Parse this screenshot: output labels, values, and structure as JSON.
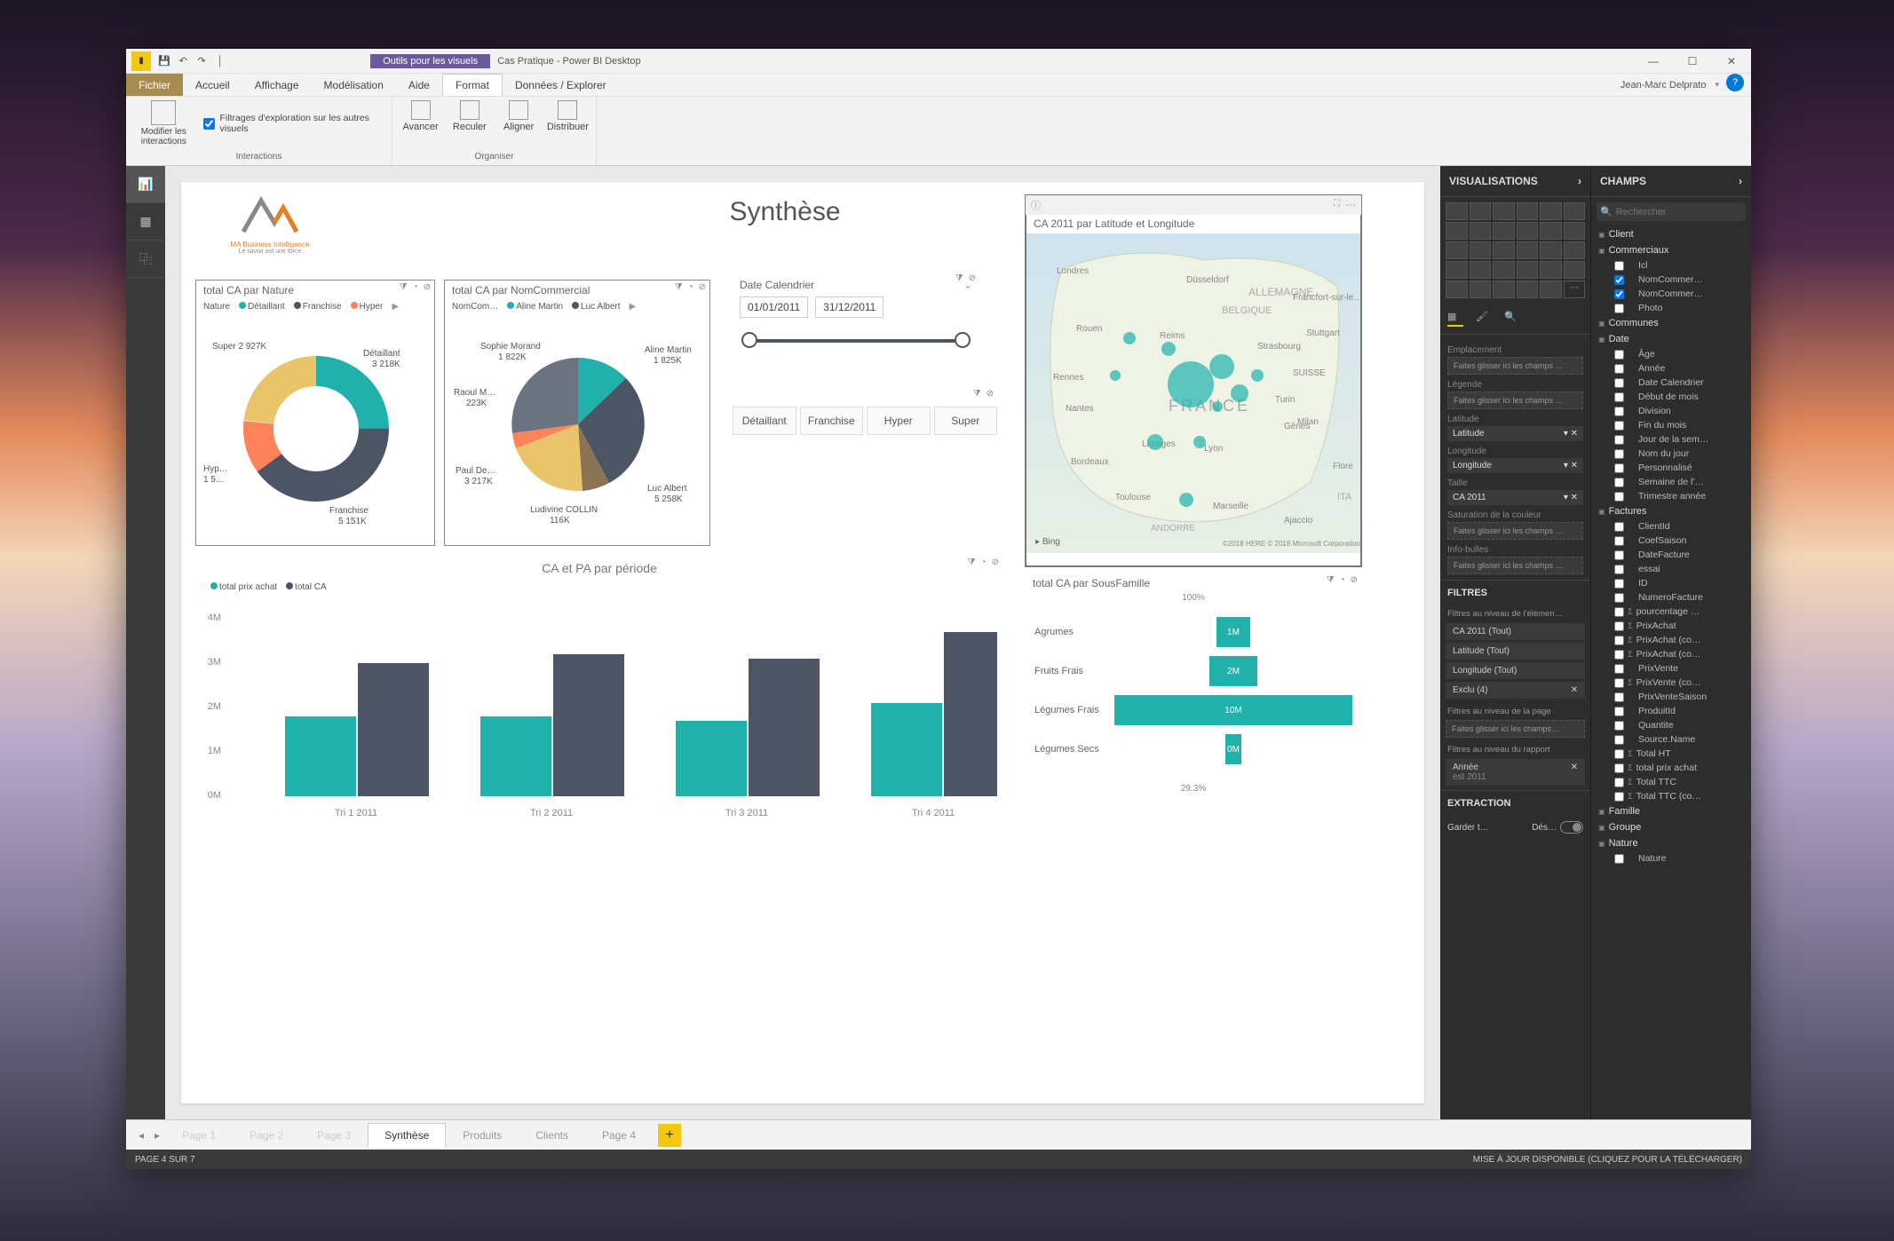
{
  "titlebar": {
    "purple_tab": "Outils pour les visuels",
    "title": "Cas Pratique - Power BI Desktop"
  },
  "menubar": {
    "file": "Fichier",
    "tabs": [
      "Accueil",
      "Affichage",
      "Modélisation",
      "Aide",
      "Format",
      "Données / Explorer"
    ],
    "active_tab_index": 4,
    "user": "Jean-Marc Delprato"
  },
  "ribbon": {
    "interactions": {
      "modify": "Modifier les interactions",
      "checkbox": "Filtrages d'exploration sur les autres visuels",
      "group": "Interactions"
    },
    "organize": {
      "buttons": [
        "Avancer",
        "Reculer",
        "Aligner",
        "Distribuer"
      ],
      "group": "Organiser"
    }
  },
  "leftbar": {
    "active": 0
  },
  "report": {
    "title": "Synthèse",
    "logo_sub1": "MA Business Intelligence",
    "logo_sub2": "Le savoir est une force",
    "donut": {
      "title": "total CA par Nature",
      "legend_label": "Nature",
      "legend": [
        {
          "name": "Détaillant",
          "color": "#20b2aa"
        },
        {
          "name": "Franchise",
          "color": "#4b5563"
        },
        {
          "name": "Hyper",
          "color": "#ff8359"
        }
      ],
      "labels": [
        {
          "name": "Super",
          "value": "2 927K"
        },
        {
          "name": "Détaillant",
          "value": "3 218K"
        },
        {
          "name": "Hyp…",
          "value": "1 5…"
        },
        {
          "name": "Franchise",
          "value": "5 151K"
        }
      ]
    },
    "pie": {
      "title": "total CA par NomCommercial",
      "legend_label": "NomCom…",
      "legend": [
        {
          "name": "Aline Martin",
          "color": "#20b2aa"
        },
        {
          "name": "Luc Albert",
          "color": "#4b5563"
        }
      ],
      "labels": [
        {
          "name": "Sophie Morand",
          "value": "1 822K"
        },
        {
          "name": "Aline Martin",
          "value": "1 825K"
        },
        {
          "name": "Raoul M…",
          "value": "223K"
        },
        {
          "name": "Paul De…",
          "value": "3 217K"
        },
        {
          "name": "Ludivine COLLIN",
          "value": "116K"
        },
        {
          "name": "Luc Albert",
          "value": "5 258K"
        }
      ]
    },
    "date_slicer": {
      "label": "Date Calendrier",
      "from": "01/01/2011",
      "to": "31/12/2011"
    },
    "nature_slicer": [
      "Détaillant",
      "Franchise",
      "Hyper",
      "Super"
    ],
    "map": {
      "title": "CA 2011 par Latitude et Longitude",
      "attrib": "©2018 HERE © 2018 Microsoft Corporation",
      "bing": "Bing"
    },
    "bar": {
      "title": "CA et PA par période",
      "legend": [
        {
          "name": "total prix achat",
          "color": "#20b2aa"
        },
        {
          "name": "total CA",
          "color": "#4b5563"
        }
      ],
      "ylabels": [
        "4M",
        "3M",
        "2M",
        "1M",
        "0M"
      ],
      "categories": [
        "Tri 1 2011",
        "Tri 2 2011",
        "Tri 3 2011",
        "Tri 4 2011"
      ]
    },
    "hbar": {
      "title": "total CA par SousFamille",
      "top": "100%",
      "rows": [
        {
          "label": "Agrumes",
          "value": "1M",
          "w": 14
        },
        {
          "label": "Fruits Frais",
          "value": "2M",
          "w": 20
        },
        {
          "label": "Légumes Frais",
          "value": "10M",
          "w": 100
        },
        {
          "label": "Légumes Secs",
          "value": "0M",
          "w": 4
        }
      ],
      "bottom": "29.3%"
    }
  },
  "viz_panel": {
    "header": "VISUALISATIONS",
    "wells": {
      "emplacement": "Emplacement",
      "legende": "Légende",
      "latitude": "Latitude",
      "longitude": "Longitude",
      "taille": "Taille",
      "saturation": "Saturation de la couleur",
      "infobulles": "Info-bulles",
      "drop": "Faites glisser ici les champs …"
    },
    "chips": {
      "latitude": "Latitude",
      "longitude": "Longitude",
      "ca": "CA 2011"
    },
    "filters_header": "FILTRES",
    "filters": {
      "element": "Filtres au niveau de l'élémen…",
      "chips": [
        "CA 2011  (Tout)",
        "Latitude  (Tout)",
        "Longitude  (Tout)",
        "Exclu (4)"
      ],
      "page": "Filtres au niveau de la page",
      "page_drop": "Faites glisser ici les champs…",
      "report": "Filtres au niveau du rapport",
      "annee": "Année",
      "annee_val": "est 2011"
    },
    "extraction": "EXTRACTION",
    "extract_row": {
      "keep": "Garder t…",
      "off": "Dés…"
    }
  },
  "fields_panel": {
    "header": "CHAMPS",
    "search": "Rechercher",
    "tables": [
      {
        "name": "Client",
        "fields": []
      },
      {
        "name": "Commerciaux",
        "fields": [
          "Icl",
          "NomCommer…",
          "NomCommer…",
          "Photo"
        ]
      },
      {
        "name": "Communes",
        "fields": []
      },
      {
        "name": "Date",
        "fields": [
          "Âge",
          "Année",
          "Date Calendrier",
          "Début de mois",
          "Division",
          "Fin du mois",
          "Jour de la sem…",
          "Nom du jour",
          "Personnalisé",
          "Semaine de l'…",
          "Trimestre année"
        ]
      },
      {
        "name": "Factures",
        "fields": [
          "ClientId",
          "CoefSaison",
          "DateFacture",
          "essai",
          "ID",
          "NumeroFacture",
          "pourcentage …",
          "PrixAchat",
          "PrixAchat (co…",
          "PrixAchat (co…",
          "PrixVente",
          "PrixVente (co…",
          "PrixVenteSaison",
          "ProduitId",
          "Quantite",
          "Source.Name",
          "Total HT",
          "total prix achat",
          "Total TTC",
          "Total TTC (co…"
        ]
      },
      {
        "name": "Famille",
        "fields": []
      },
      {
        "name": "Groupe",
        "fields": []
      },
      {
        "name": "Nature",
        "fields": [
          "Nature"
        ]
      }
    ],
    "checked": [
      "NomCommer…"
    ],
    "sigma": [
      "PrixAchat",
      "Total HT",
      "total prix achat",
      "Total TTC",
      "Total TTC (co…",
      "pourcentage …",
      "PrixAchat (co…",
      "PrixAchat (co…",
      "PrixVente (co…"
    ]
  },
  "pagetabs": {
    "pages": [
      "Page 1",
      "Page 2",
      "Page 3",
      "Synthèse",
      "Produits",
      "Clients",
      "Page 4"
    ],
    "active": 3
  },
  "statusbar": {
    "left": "PAGE 4 SUR 7",
    "right": "MISE À JOUR DISPONIBLE (CLIQUEZ POUR LA TÉLÉCHARGER)"
  },
  "chart_data": [
    {
      "type": "pie",
      "title": "total CA par Nature",
      "donut": true,
      "series": [
        {
          "name": "CA",
          "values": [
            3218,
            5151,
            1500,
            2927
          ]
        }
      ],
      "categories": [
        "Détaillant",
        "Franchise",
        "Hyper",
        "Super"
      ],
      "unit": "K"
    },
    {
      "type": "pie",
      "title": "total CA par NomCommercial",
      "series": [
        {
          "name": "CA",
          "values": [
            1825,
            5258,
            116,
            3217,
            223,
            1822
          ]
        }
      ],
      "categories": [
        "Aline Martin",
        "Luc Albert",
        "Ludivine COLLIN",
        "Paul De…",
        "Raoul M…",
        "Sophie Morand"
      ],
      "unit": "K"
    },
    {
      "type": "bar",
      "title": "CA et PA par période",
      "categories": [
        "Tri 1 2011",
        "Tri 2 2011",
        "Tri 3 2011",
        "Tri 4 2011"
      ],
      "series": [
        {
          "name": "total prix achat",
          "values": [
            1.8,
            1.8,
            1.7,
            2.1
          ]
        },
        {
          "name": "total CA",
          "values": [
            3.0,
            3.2,
            3.1,
            3.7
          ]
        }
      ],
      "ylabel": "",
      "ylim": [
        0,
        4
      ],
      "unit": "M"
    },
    {
      "type": "bar",
      "orientation": "horizontal",
      "title": "total CA par SousFamille",
      "categories": [
        "Agrumes",
        "Fruits Frais",
        "Légumes Frais",
        "Légumes Secs"
      ],
      "values": [
        1,
        2,
        10,
        0
      ],
      "unit": "M"
    }
  ]
}
